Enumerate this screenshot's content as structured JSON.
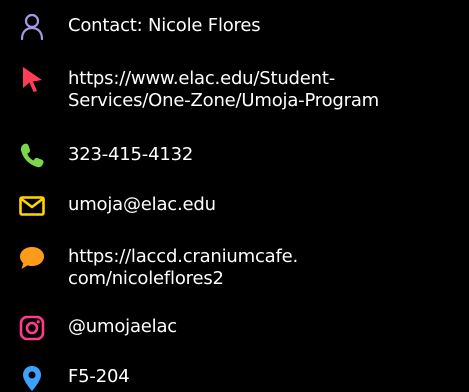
{
  "contact": {
    "name_label": "Contact: Nicole Flores",
    "website_line1": "https://www.elac.edu/Student-",
    "website_line2": "Services/One-Zone/Umoja-Program",
    "phone": "323-415-4132",
    "email": "umoja@elac.edu",
    "chat_line1": "https://laccd.craniumcafe.",
    "chat_line2": "com/nicoleflores2",
    "instagram": "@umojaelac",
    "location": "F5-204"
  },
  "icons": {
    "person": {
      "name": "person-icon",
      "color": "#a79ae6"
    },
    "cursor": {
      "name": "cursor-arrow-icon",
      "color": "#ff3d57"
    },
    "phone": {
      "name": "phone-icon",
      "color": "#7cd64b"
    },
    "mail": {
      "name": "mail-icon",
      "color": "#ffd400"
    },
    "chat": {
      "name": "chat-bubble-icon",
      "color": "#ff9b1a"
    },
    "instagram": {
      "name": "instagram-icon",
      "color": "#ff3a8c"
    },
    "location": {
      "name": "location-pin-icon",
      "color": "#3ba3ff"
    }
  }
}
